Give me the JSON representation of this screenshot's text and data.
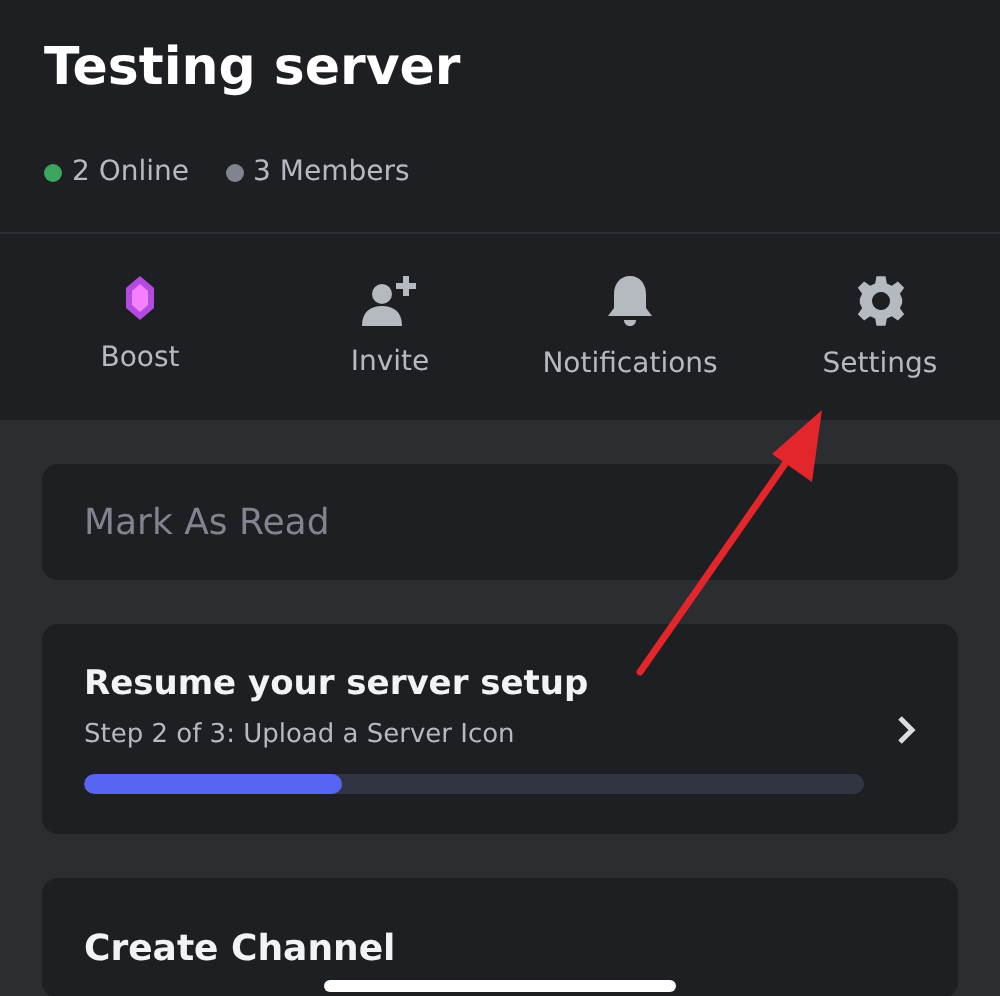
{
  "server": {
    "title": "Testing server"
  },
  "stats": [
    {
      "label": "2 Online",
      "color": "#3ba55d"
    },
    {
      "label": "3 Members",
      "color": "#80848e"
    }
  ],
  "actions": [
    {
      "kind": "boost",
      "label": "Boost"
    },
    {
      "kind": "invite",
      "label": "Invite"
    },
    {
      "kind": "notifications",
      "label": "Notifications"
    },
    {
      "kind": "settings",
      "label": "Settings"
    }
  ],
  "mark_as_read": {
    "label": "Mark As Read",
    "disabled": true
  },
  "setup": {
    "title": "Resume your server setup",
    "subtitle": "Step 2 of 3: Upload a Server Icon",
    "level": 0.33
  },
  "create_channel": {
    "label": "Create Channel"
  }
}
